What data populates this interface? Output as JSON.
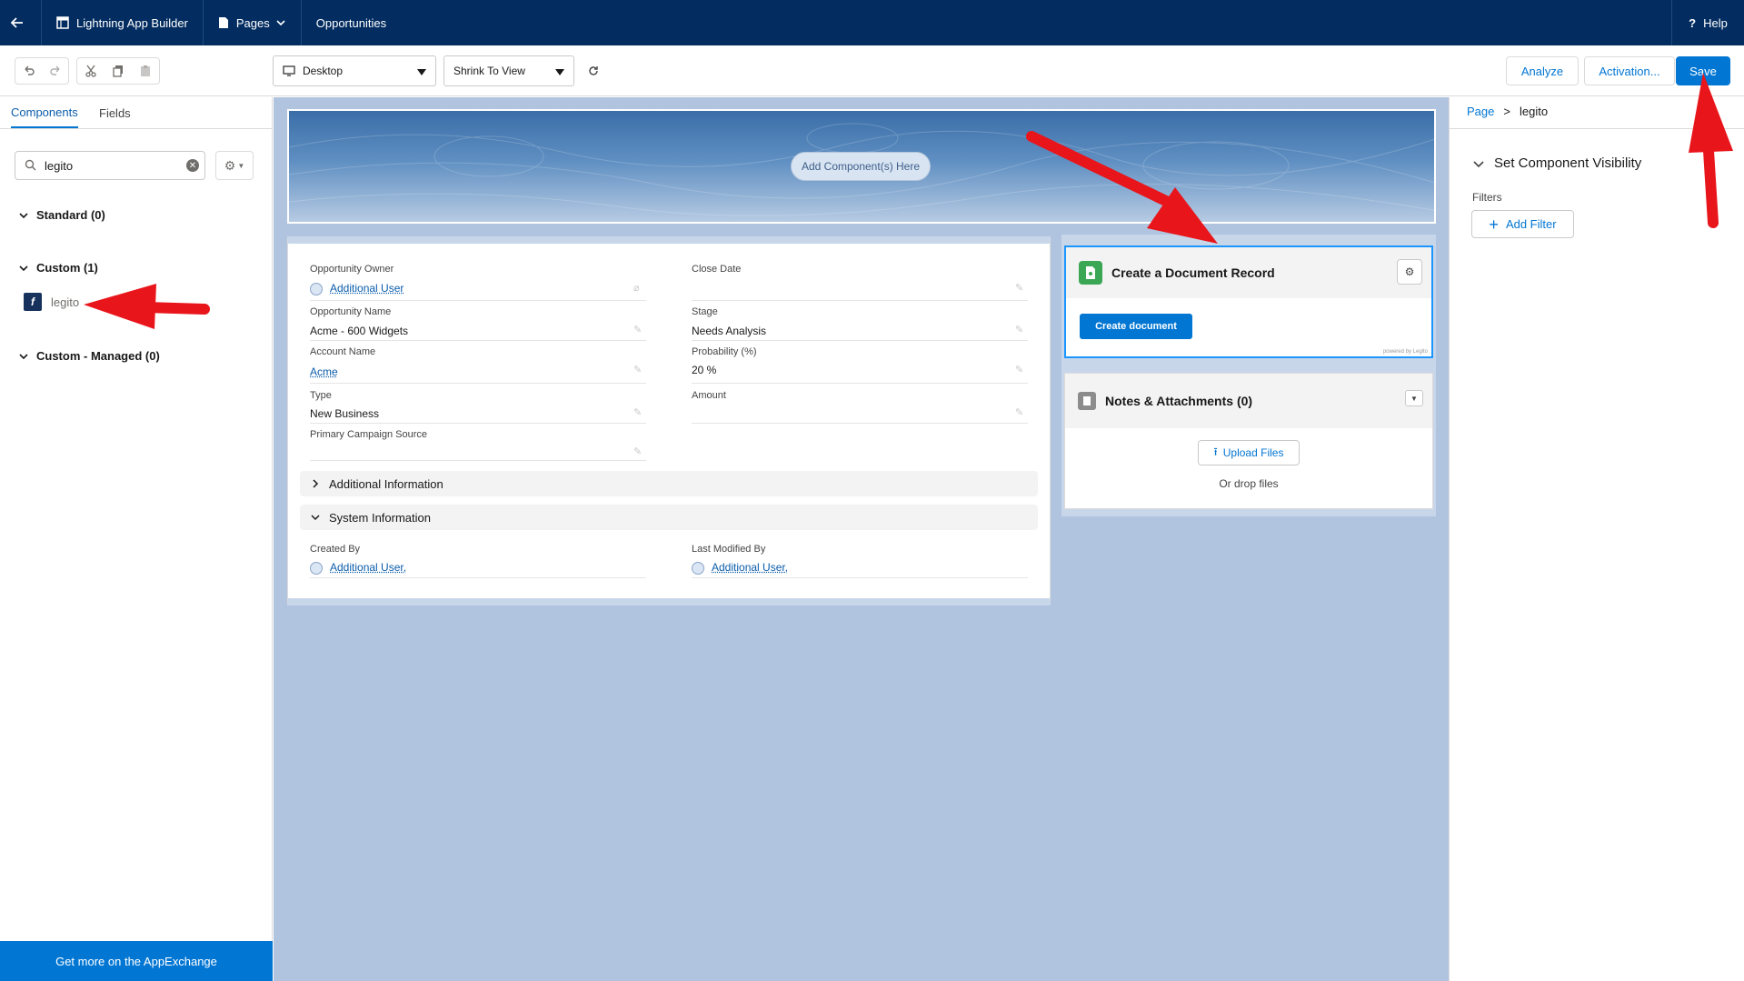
{
  "header": {
    "app_builder": "Lightning App Builder",
    "pages": "Pages",
    "page_name": "Opportunities",
    "help": "Help"
  },
  "toolbar": {
    "form_factor": "Desktop",
    "zoom": "Shrink To View",
    "analyze": "Analyze",
    "activation": "Activation...",
    "save": "Save"
  },
  "left_panel": {
    "tabs": [
      "Components",
      "Fields"
    ],
    "search_value": "legito",
    "groups": [
      {
        "label": "Standard (0)"
      },
      {
        "label": "Custom (1)",
        "items": [
          "legito"
        ]
      },
      {
        "label": "Custom - Managed (0)"
      }
    ],
    "appexchange": "Get more on the AppExchange"
  },
  "canvas": {
    "add_component": "Add Component(s) Here",
    "fields_left": [
      {
        "label": "Opportunity Owner",
        "value": "Additional User",
        "link": true
      },
      {
        "label": "Opportunity Name",
        "value": "Acme - 600 Widgets"
      },
      {
        "label": "Account Name",
        "value": "Acme",
        "link": true
      },
      {
        "label": "Type",
        "value": "New Business"
      },
      {
        "label": "Primary Campaign Source",
        "value": ""
      }
    ],
    "fields_right": [
      {
        "label": "Close Date",
        "value": ""
      },
      {
        "label": "Stage",
        "value": "Needs Analysis"
      },
      {
        "label": "Probability (%)",
        "value": "20 %"
      },
      {
        "label": "Amount",
        "value": ""
      }
    ],
    "additional_info": "Additional Information",
    "system_info": "System Information",
    "created_by_label": "Created By",
    "created_by_value": "Additional User,",
    "modified_by_label": "Last Modified By",
    "modified_by_value": "Additional User,",
    "doc_card_title": "Create a Document Record",
    "doc_card_button": "Create document",
    "doc_card_powered": "powered by Legito",
    "notes_title": "Notes & Attachments (0)",
    "upload_files": "Upload Files",
    "drop_files": "Or drop files"
  },
  "right_panel": {
    "breadcrumb_root": "Page",
    "breadcrumb_sep": ">",
    "breadcrumb_current": "legito",
    "visibility_title": "Set Component Visibility",
    "filters_label": "Filters",
    "add_filter": "Add Filter"
  },
  "colors": {
    "header_bg": "#032d60",
    "brand": "#0176d3",
    "canvas_bg": "#b0c4df",
    "annotation_arrow": "#e8151b"
  }
}
